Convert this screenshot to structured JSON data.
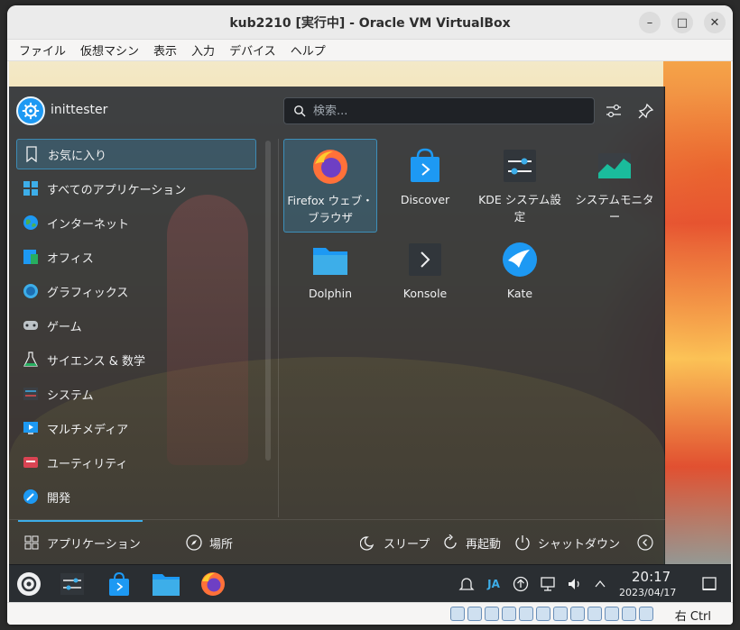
{
  "window": {
    "title": "kub2210 [実行中] - Oracle VM VirtualBox",
    "controls": [
      "–",
      "□",
      "✕"
    ]
  },
  "menubar": {
    "items": [
      "ファイル",
      "仮想マシン",
      "表示",
      "入力",
      "デバイス",
      "ヘルプ"
    ]
  },
  "launcher": {
    "user": "inittester",
    "search_placeholder": "検索...",
    "categories": [
      {
        "label": "お気に入り",
        "icon": "bookmark-icon",
        "active": true
      },
      {
        "label": "すべてのアプリケーション",
        "icon": "grid-icon"
      },
      {
        "label": "インターネット",
        "icon": "globe-icon"
      },
      {
        "label": "オフィス",
        "icon": "office-icon"
      },
      {
        "label": "グラフィックス",
        "icon": "graphics-icon"
      },
      {
        "label": "ゲーム",
        "icon": "gamepad-icon"
      },
      {
        "label": "サイエンス & 数学",
        "icon": "flask-icon"
      },
      {
        "label": "システム",
        "icon": "system-icon"
      },
      {
        "label": "マルチメディア",
        "icon": "multimedia-icon"
      },
      {
        "label": "ユーティリティ",
        "icon": "utilities-icon"
      },
      {
        "label": "開発",
        "icon": "hammer-icon"
      }
    ],
    "apps": [
      {
        "label": "Firefox ウェブ・ブラウザ",
        "icon": "firefox-icon",
        "selected": true
      },
      {
        "label": "Discover",
        "icon": "discover-icon"
      },
      {
        "label": "KDE システム設定",
        "icon": "settings-icon"
      },
      {
        "label": "システムモニター",
        "icon": "system-monitor-icon"
      },
      {
        "label": "Dolphin",
        "icon": "folder-icon"
      },
      {
        "label": "Konsole",
        "icon": "terminal-icon"
      },
      {
        "label": "Kate",
        "icon": "kate-icon"
      }
    ],
    "footer": {
      "applications": "アプリケーション",
      "places": "場所",
      "sleep": "スリープ",
      "restart": "再起動",
      "shutdown": "シャットダウン"
    }
  },
  "panel": {
    "tray_lang": "JA",
    "time": "20:17",
    "date": "2023/04/17"
  },
  "statusbar": {
    "host_key": "右 Ctrl"
  },
  "colors": {
    "accent": "#3daee9",
    "launcher_bg": "#2a2e32"
  }
}
